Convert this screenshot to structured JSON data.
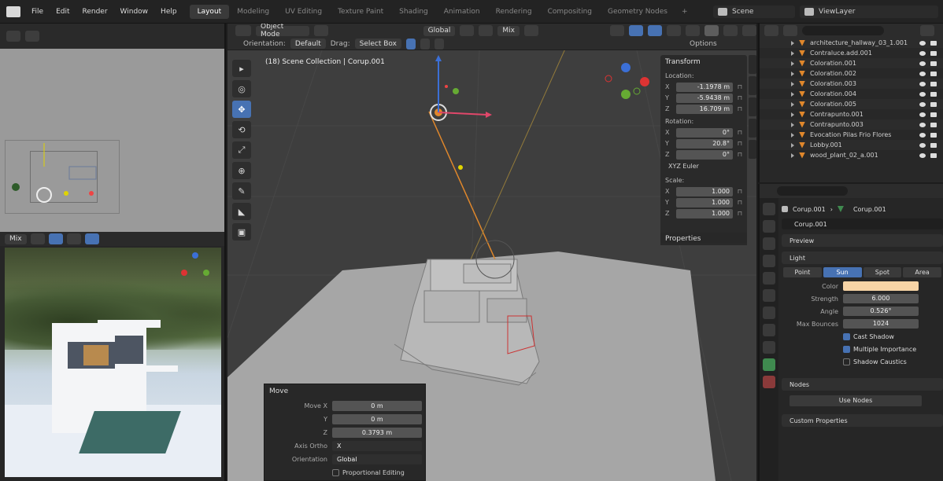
{
  "topbar": {
    "menus": [
      "File",
      "Edit",
      "Render",
      "Window",
      "Help"
    ],
    "workspaces": [
      "Layout",
      "Modeling",
      "UV Editing",
      "Texture Paint",
      "Shading",
      "Animation",
      "Rendering",
      "Compositing",
      "Geometry Nodes"
    ],
    "active_workspace": "Layout",
    "add_tab": "+",
    "scene": "Scene",
    "view_layer": "ViewLayer"
  },
  "viewport": {
    "mode": "Object Mode",
    "transform_orientation": "Global",
    "shading_option": "Mix",
    "orientation_label": "Orientation:",
    "orientation_value": "Default",
    "drag_label": "Drag:",
    "drag_value": "Select Box",
    "options": "Options",
    "collection_label": "(18) Scene Collection | Corup.001",
    "tools": [
      "▸",
      "◎",
      "✥",
      "⟲",
      "⤢",
      "⊕",
      "✎",
      "◣",
      "▣"
    ]
  },
  "npanel": {
    "title": "Transform",
    "location_label": "Location:",
    "location": [
      {
        "axis": "X",
        "value": "-1.1978 m"
      },
      {
        "axis": "Y",
        "value": "-5.9438 m"
      },
      {
        "axis": "Z",
        "value": "16.709 m"
      }
    ],
    "rotation_label": "Rotation:",
    "rotation": [
      {
        "axis": "X",
        "value": "0°"
      },
      {
        "axis": "Y",
        "value": "20.8°"
      },
      {
        "axis": "Z",
        "value": "0°"
      }
    ],
    "rotation_mode": "XYZ Euler",
    "scale_label": "Scale:",
    "scale": [
      {
        "axis": "X",
        "value": "1.000"
      },
      {
        "axis": "Y",
        "value": "1.000"
      },
      {
        "axis": "Z",
        "value": "1.000"
      }
    ],
    "properties_label": "Properties"
  },
  "redo_panel": {
    "title": "Move",
    "rows": [
      {
        "label": "Move X",
        "value": "0 m"
      },
      {
        "label": "Y",
        "value": "0 m"
      },
      {
        "label": "Z",
        "value": "0.3793 m"
      }
    ],
    "axis_label": "Axis Ortho",
    "axis_value": "X",
    "orientation_label": "Orientation",
    "orientation_value": "Global",
    "proportional_label": "Proportional Editing"
  },
  "outliner": {
    "items": [
      "architecture_hallway_03_1.001",
      "Contraluce.add.001",
      "Coloration.001",
      "Coloration.002",
      "Coloration.003",
      "Coloration.004",
      "Coloration.005",
      "Contrapunto.001",
      "Contrapunto.003",
      "Evocation Pilas Frio Flores",
      "Lobby.001",
      "wood_plant_02_a.001"
    ]
  },
  "properties": {
    "crumb_object": "Corup.001",
    "crumb_data": "Corup.001",
    "data_name": "Corup.001",
    "preview_label": "Preview",
    "light_label": "Light",
    "light_types": [
      "Point",
      "Sun",
      "Spot",
      "Area"
    ],
    "active_light_type": "Sun",
    "color_label": "Color",
    "color_value": "#f7d4a6",
    "strength_label": "Strength",
    "strength_value": "6.000",
    "angle_label": "Angle",
    "angle_value": "0.526°",
    "max_bounces_label": "Max Bounces",
    "max_bounces_value": "1024",
    "cast_shadow": "Cast Shadow",
    "multiple_importance": "Multiple Importance",
    "shadow_caustics": "Shadow Caustics",
    "nodes_label": "Nodes",
    "use_nodes": "Use Nodes",
    "custom_props": "Custom Properties"
  },
  "left_bottom": {
    "shading_option": "Mix"
  }
}
